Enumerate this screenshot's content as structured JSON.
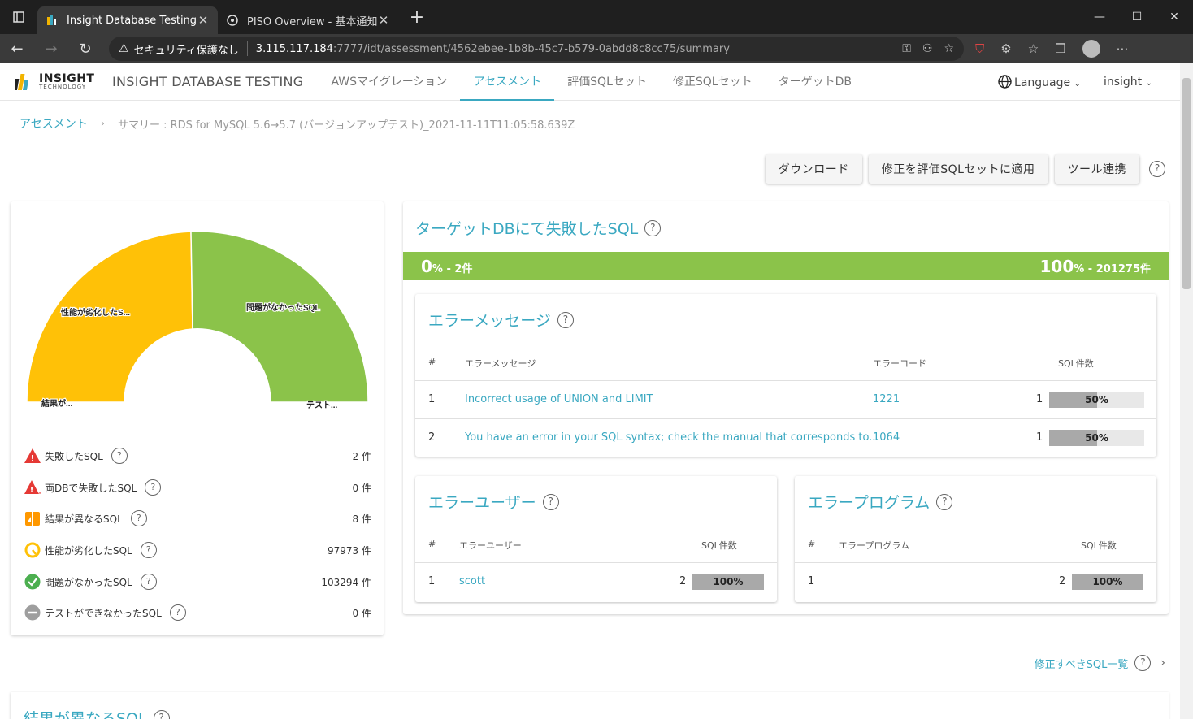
{
  "browser": {
    "tabs": [
      {
        "title": "Insight Database Testing",
        "active": true
      },
      {
        "title": "PISO Overview - 基本通知",
        "active": false
      }
    ],
    "address": {
      "security_label": "セキュリティ保護なし",
      "host": "3.115.117.184",
      "path": ":7777/idt/assessment/4562ebee-1b8b-45c7-b579-0abdd8c8cc75/summary"
    }
  },
  "header": {
    "logo_line1": "INSIGHT",
    "logo_line2": "TECHNOLOGY",
    "product_name": "INSIGHT DATABASE TESTING",
    "nav": [
      {
        "label": "AWSマイグレーション",
        "active": false
      },
      {
        "label": "アセスメント",
        "active": true
      },
      {
        "label": "評価SQLセット",
        "active": false
      },
      {
        "label": "修正SQLセット",
        "active": false
      },
      {
        "label": "ターゲットDB",
        "active": false
      }
    ],
    "language_label": "Language",
    "user_label": "insight"
  },
  "breadcrumb": {
    "root": "アセスメント",
    "current": "サマリー : RDS for MySQL 5.6→5.7 (バージョンアップテスト)_2021-11-11T11:05:58.639Z"
  },
  "actions": {
    "download": "ダウンロード",
    "apply": "修正を評価SQLセットに適用",
    "tool": "ツール連携"
  },
  "summary": {
    "gauge_labels": {
      "degraded": "性能が劣化したS...",
      "ok": "問題がなかったSQL",
      "diff": "結果が...",
      "untested": "テスト..."
    },
    "stats": [
      {
        "label": "失敗したSQL",
        "value": "2 件",
        "icon": "failed-warning-icon"
      },
      {
        "label": "両DBで失敗したSQL",
        "value": "0 件",
        "icon": "both-failed-warning-icon"
      },
      {
        "label": "結果が異なるSQL",
        "value": "8 件",
        "icon": "result-diff-icon"
      },
      {
        "label": "性能が劣化したSQL",
        "value": "97973 件",
        "icon": "performance-degraded-icon"
      },
      {
        "label": "問題がなかったSQL",
        "value": "103294 件",
        "icon": "ok-check-icon"
      },
      {
        "label": "テストができなかったSQL",
        "value": "0 件",
        "icon": "untested-minus-icon"
      }
    ],
    "colors": {
      "degraded": "#ffc107",
      "ok": "#8bc34a",
      "failed": "#e53935"
    }
  },
  "target_failed": {
    "title": "ターゲットDBにて失敗したSQL",
    "left_pct": "0",
    "left_count": "% - 2件",
    "right_pct": "100",
    "right_count": "% - 201275件",
    "error_messages": {
      "title": "エラーメッセージ",
      "columns": {
        "num": "#",
        "message": "エラーメッセージ",
        "code": "エラーコード",
        "count": "SQL件数"
      },
      "rows": [
        {
          "num": "1",
          "message": "Incorrect usage of UNION and LIMIT",
          "code": "1221",
          "count": "1",
          "pct": "50%",
          "fraction": 0.5
        },
        {
          "num": "2",
          "message": "You have an error in your SQL syntax; check the manual that corresponds to...",
          "code": "1064",
          "count": "1",
          "pct": "50%",
          "fraction": 0.5
        }
      ]
    },
    "error_users": {
      "title": "エラーユーザー",
      "columns": {
        "num": "#",
        "user": "エラーユーザー",
        "count": "SQL件数"
      },
      "rows": [
        {
          "num": "1",
          "user": "scott",
          "count": "2",
          "pct": "100%",
          "fraction": 1.0
        }
      ]
    },
    "error_programs": {
      "title": "エラープログラム",
      "columns": {
        "num": "#",
        "program": "エラープログラム",
        "count": "SQL件数"
      },
      "rows": [
        {
          "num": "1",
          "program": "",
          "count": "2",
          "pct": "100%",
          "fraction": 1.0
        }
      ]
    }
  },
  "bottom": {
    "fix_link": "修正すべきSQL一覧",
    "next_section": "結果が異なるSQL"
  }
}
